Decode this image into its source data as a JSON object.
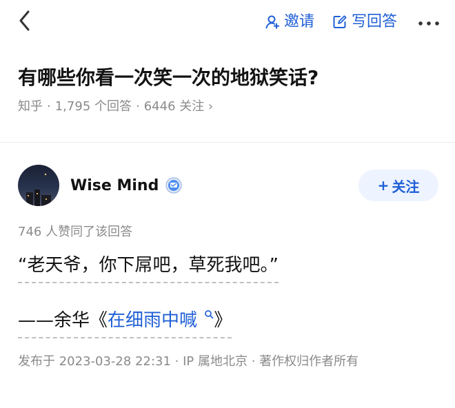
{
  "nav": {
    "invite_label": "邀请",
    "write_answer_label": "写回答"
  },
  "question": {
    "title": "有哪些你看一次笑一次的地狱笑话?",
    "source": "知乎",
    "answers_count": "1,795 个回答",
    "followers_count": "6446 关注",
    "dot": "·",
    "chevron": "›"
  },
  "answer": {
    "author_name": "Wise Mind",
    "follow_label": "关注",
    "follow_plus": "+",
    "likes_text": "746 人赞同了该回答",
    "quote": "“老天爷，你下屌吧，草死我吧。”",
    "source_prefix": "——余华",
    "source_open_bracket": "《",
    "source_book": "在细雨中喊",
    "source_close_bracket": "》",
    "publish_meta": "发布于 2023-03-28 22:31 · IP 属地北京 · 著作权归作者所有"
  },
  "icons": {
    "back": "back-icon",
    "invite": "person-add-icon",
    "write": "edit-icon",
    "more": "more-icon",
    "verify": "verified-badge-icon",
    "search": "search-icon"
  },
  "colors": {
    "accent": "#1f5fd6",
    "text_primary": "#121212",
    "text_secondary": "#8a8a8a",
    "follow_bg": "#edf3ff",
    "divider": "#ececec"
  }
}
